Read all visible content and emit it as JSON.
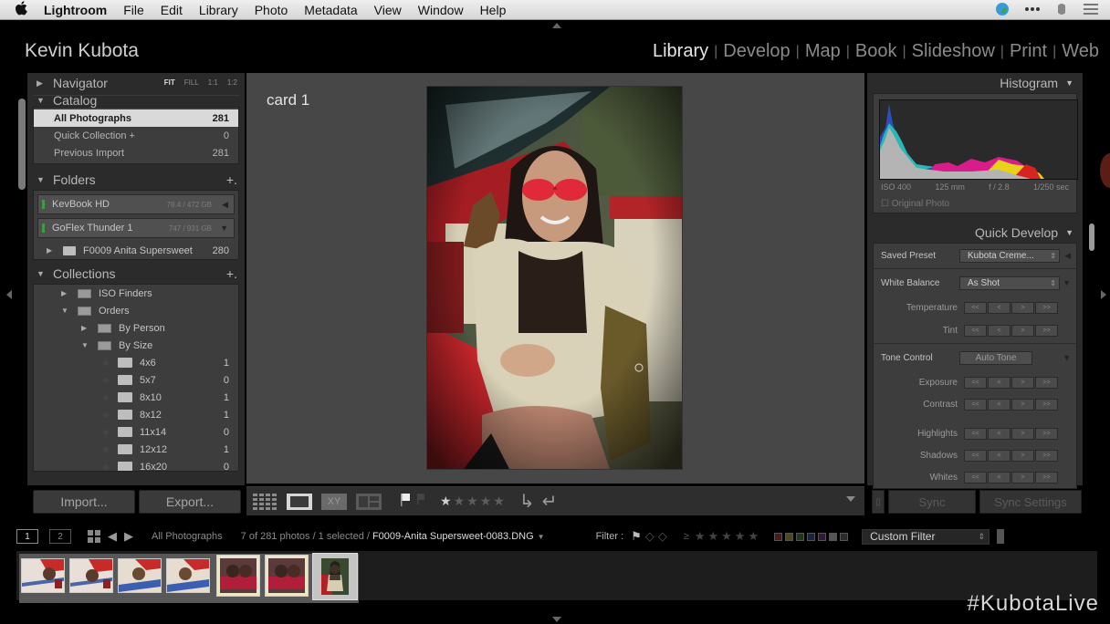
{
  "menubar": {
    "app": "Lightroom",
    "items": [
      "File",
      "Edit",
      "Library",
      "Photo",
      "Metadata",
      "View",
      "Window",
      "Help"
    ],
    "status_icons": [
      "cloud-sync-icon",
      "more-icon",
      "hand-icon",
      "list-icon"
    ]
  },
  "identity_plate": "Kevin Kubota",
  "modules": [
    {
      "label": "Library",
      "active": true
    },
    {
      "label": "Develop",
      "active": false
    },
    {
      "label": "Map",
      "active": false
    },
    {
      "label": "Book",
      "active": false
    },
    {
      "label": "Slideshow",
      "active": false
    },
    {
      "label": "Print",
      "active": false
    },
    {
      "label": "Web",
      "active": false
    }
  ],
  "left_panel": {
    "navigator": {
      "title": "Navigator",
      "zoom_options": [
        "FIT",
        "FILL",
        "1:1",
        "1:2"
      ],
      "zoom_selected": "FIT"
    },
    "catalog": {
      "title": "Catalog",
      "items": [
        {
          "label": "All Photographs",
          "count": "281",
          "selected": true
        },
        {
          "label": "Quick Collection +",
          "count": "0"
        },
        {
          "label": "Previous Import",
          "count": "281"
        }
      ]
    },
    "folders": {
      "title": "Folders",
      "add": "+.",
      "volumes": [
        {
          "label": "KevBook HD",
          "size": "78.4 / 472 GB"
        },
        {
          "label": "GoFlex Thunder 1",
          "size": "747 / 931 GB"
        }
      ],
      "items": [
        {
          "label": "F0009 Anita Supersweet",
          "count": "280"
        }
      ]
    },
    "collections": {
      "title": "Collections",
      "add": "+.",
      "sets": [
        {
          "label": "ISO Finders"
        },
        {
          "label": "Orders"
        },
        {
          "label": "By Person"
        },
        {
          "label": "By Size"
        }
      ],
      "items": [
        {
          "label": "4x6",
          "count": "1"
        },
        {
          "label": "5x7",
          "count": "0"
        },
        {
          "label": "8x10",
          "count": "1"
        },
        {
          "label": "8x12",
          "count": "1"
        },
        {
          "label": "11x14",
          "count": "0"
        },
        {
          "label": "12x12",
          "count": "1"
        },
        {
          "label": "16x20",
          "count": "0"
        }
      ]
    },
    "import_label": "Import...",
    "export_label": "Export..."
  },
  "center": {
    "card_label": "card 1",
    "photo_description": "Woman with long dark hair and red heart sunglasses sitting in a red vintage car"
  },
  "toolbar": {
    "view_modes": [
      "grid-view",
      "loupe-view",
      "compare-view",
      "survey-view"
    ],
    "compare_label": "XY",
    "rating": 1,
    "rating_max": 5,
    "rotate_left": "rotate-ccw",
    "rotate_right": "rotate-cw"
  },
  "right_panel": {
    "histogram": {
      "title": "Histogram",
      "iso": "ISO 400",
      "focal": "125 mm",
      "aperture": "f / 2.8",
      "shutter": "1/250 sec",
      "original_photo": "Original Photo"
    },
    "quick_develop": {
      "title": "Quick Develop",
      "saved_preset_label": "Saved Preset",
      "saved_preset_value": "Kubota Creme...",
      "white_balance_label": "White Balance",
      "white_balance_value": "As Shot",
      "wb_adjust": [
        "Temperature",
        "Tint"
      ],
      "tone_control_label": "Tone Control",
      "auto_tone_label": "Auto Tone",
      "tone_adjust": [
        "Exposure",
        "Contrast",
        "Highlights",
        "Shadows",
        "Whites"
      ],
      "step_buttons": [
        "<<",
        "<",
        ">",
        ">>"
      ]
    },
    "sync_label": "Sync",
    "sync_settings_label": "Sync Settings"
  },
  "filmstrip_bar": {
    "monitor1": "1",
    "monitor2": "2",
    "source": "All Photographs",
    "status": "7 of 281 photos / 1 selected /",
    "filename": "F0009-Anita Supersweet-0083.DNG",
    "filter_label": "Filter :",
    "rating_op": "≥",
    "custom_filter": "Custom Filter",
    "color_labels": [
      "#c23b3b",
      "#c9c23a",
      "#3f9a3f",
      "#3c5fb8",
      "#8a3db0"
    ]
  },
  "filmstrip": {
    "thumbnails": [
      {
        "type": "car-red-white",
        "picked": false,
        "selected": false
      },
      {
        "type": "car-red-white",
        "picked": false,
        "selected": false
      },
      {
        "type": "car-blue-white",
        "picked": false,
        "selected": false
      },
      {
        "type": "car-blue-white",
        "picked": false,
        "selected": false
      },
      {
        "type": "car-interior",
        "picked": true,
        "selected": false
      },
      {
        "type": "car-interior",
        "picked": true,
        "selected": false
      },
      {
        "type": "portrait",
        "picked": false,
        "selected": true
      }
    ]
  },
  "watermark": "#KubotaLive"
}
